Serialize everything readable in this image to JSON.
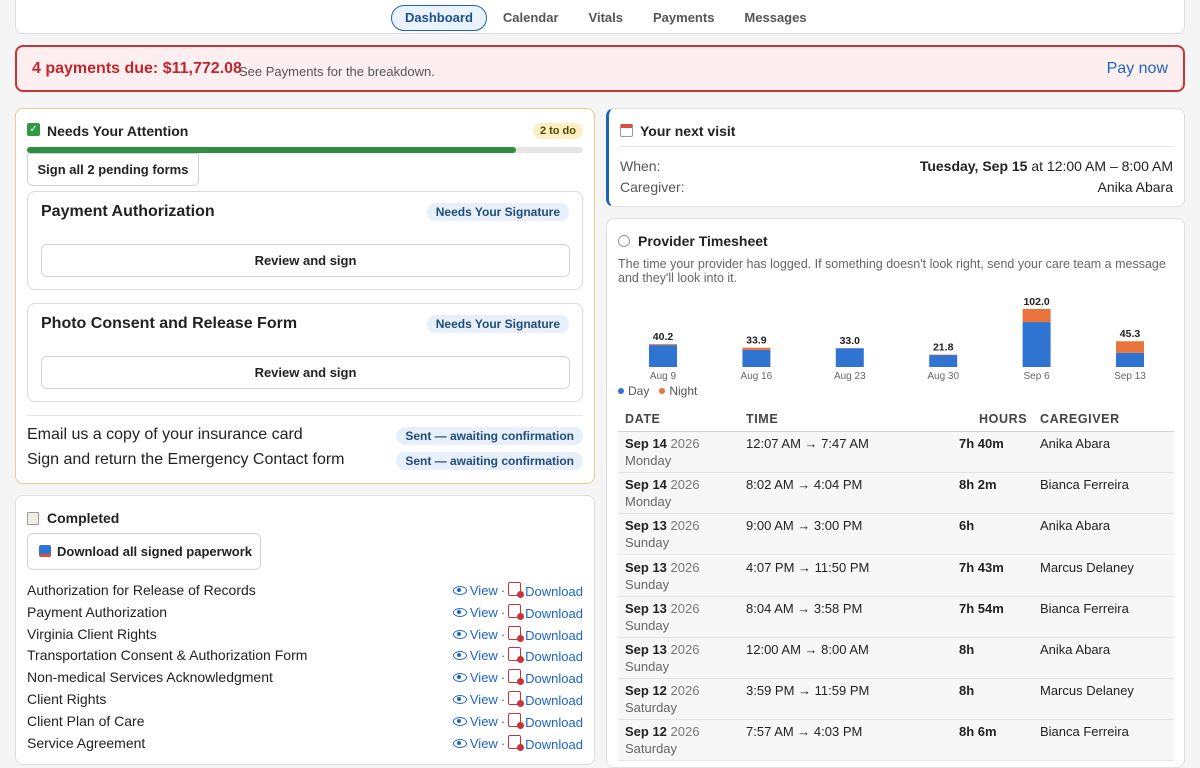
{
  "nav": {
    "tabs": [
      {
        "label": "Dashboard",
        "active": true
      },
      {
        "label": "Calendar",
        "active": false
      },
      {
        "label": "Vitals",
        "active": false
      },
      {
        "label": "Payments",
        "active": false
      },
      {
        "label": "Messages",
        "active": false
      }
    ]
  },
  "alert": {
    "main": "4 payments due: $11,772.08",
    "sub": "See Payments for the breakdown.",
    "action": "Pay now"
  },
  "attention": {
    "title": "Needs Your Attention",
    "todo_badge": "2 to do",
    "progress": 0.88,
    "sign_all": "Sign all 2 pending forms",
    "forms": [
      {
        "title": "Payment Authorization",
        "status": "Needs Your Signature",
        "action": "Review and sign"
      },
      {
        "title": "Photo Consent and Release Form",
        "status": "Needs Your Signature",
        "action": "Review and sign"
      }
    ],
    "tasks": [
      {
        "label": "Email us a copy of your insurance card",
        "status": "Sent — awaiting confirmation"
      },
      {
        "label": "Sign and return the Emergency Contact form",
        "status": "Sent — awaiting confirmation"
      }
    ]
  },
  "completed": {
    "title": "Completed",
    "download_all": "Download all signed paperwork",
    "view_label": "View",
    "sep": "·",
    "download_label": "Download",
    "docs": [
      "Authorization for Release of Records",
      "Payment Authorization",
      "Virginia Client Rights",
      "Transportation Consent & Authorization Form",
      "Non-medical Services Acknowledgment",
      "Client Rights",
      "Client Plan of Care",
      "Service Agreement"
    ]
  },
  "visit": {
    "title": "Your next visit",
    "when_label": "When:",
    "when_date": "Tuesday, Sep 15",
    "when_time": "at 12:00 AM – 8:00 AM",
    "caregiver_label": "Caregiver:",
    "caregiver": "Anika Abara"
  },
  "timesheet": {
    "title": "Provider Timesheet",
    "description": "The time your provider has logged. If something doesn't look right, send your care team a message and they'll look into it.",
    "colors": {
      "day": "#2f74d0",
      "night": "#e8743b"
    },
    "legend": {
      "day": "Day",
      "night": "Night"
    },
    "columns": {
      "date": "DATE",
      "time": "TIME",
      "hours": "HOURS",
      "caregiver": "CAREGIVER"
    },
    "rows": [
      {
        "date": "Sep 14",
        "year": "2026",
        "dow": "Monday",
        "time": "12:07 AM → 7:47 AM",
        "hours": "7h 40m",
        "caregiver": "Anika Abara"
      },
      {
        "date": "Sep 14",
        "year": "2026",
        "dow": "Monday",
        "time": "8:02 AM → 4:04 PM",
        "hours": "8h 2m",
        "caregiver": "Bianca Ferreira"
      },
      {
        "date": "Sep 13",
        "year": "2026",
        "dow": "Sunday",
        "time": "9:00 AM → 3:00 PM",
        "hours": "6h",
        "caregiver": "Anika Abara"
      },
      {
        "date": "Sep 13",
        "year": "2026",
        "dow": "Sunday",
        "time": "4:07 PM → 11:50 PM",
        "hours": "7h 43m",
        "caregiver": "Marcus Delaney"
      },
      {
        "date": "Sep 13",
        "year": "2026",
        "dow": "Sunday",
        "time": "8:04 AM → 3:58 PM",
        "hours": "7h 54m",
        "caregiver": "Bianca Ferreira"
      },
      {
        "date": "Sep 13",
        "year": "2026",
        "dow": "Sunday",
        "time": "12:00 AM → 8:00 AM",
        "hours": "8h",
        "caregiver": "Anika Abara"
      },
      {
        "date": "Sep 12",
        "year": "2026",
        "dow": "Saturday",
        "time": "3:59 PM → 11:59 PM",
        "hours": "8h",
        "caregiver": "Marcus Delaney"
      },
      {
        "date": "Sep 12",
        "year": "2026",
        "dow": "Saturday",
        "time": "7:57 AM → 4:03 PM",
        "hours": "8h 6m",
        "caregiver": "Bianca Ferreira"
      }
    ]
  },
  "chart_data": {
    "type": "bar",
    "stacked": true,
    "categories": [
      "Aug 9",
      "Aug 16",
      "Aug 23",
      "Aug 30",
      "Sep 6",
      "Sep 13"
    ],
    "totals": [
      "40.2",
      "33.9",
      "33.0",
      "21.8",
      "102.0",
      "45.3"
    ],
    "series": [
      {
        "name": "Day",
        "values": [
          38.5,
          30.0,
          33.0,
          21.0,
          79.0,
          25.0
        ]
      },
      {
        "name": "Night",
        "values": [
          1.7,
          3.9,
          0.0,
          0.8,
          23.0,
          20.3
        ]
      }
    ],
    "ylim": [
      0,
      102.0
    ]
  }
}
